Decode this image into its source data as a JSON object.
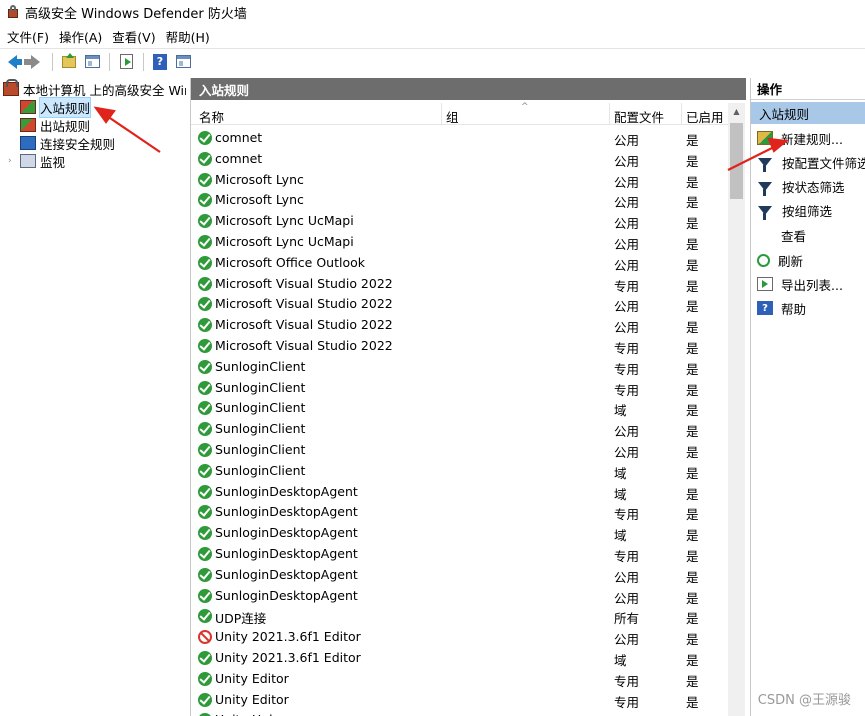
{
  "window": {
    "title": "高级安全 Windows Defender 防火墙"
  },
  "menu": [
    "文件(F)",
    "操作(A)",
    "查看(V)",
    "帮助(H)"
  ],
  "tree": {
    "root": "本地计算机 上的高级安全 Windows Defender 防火墙",
    "items": [
      {
        "label": "入站规则",
        "selected": true
      },
      {
        "label": "出站规则"
      },
      {
        "label": "连接安全规则"
      },
      {
        "label": "监视"
      }
    ]
  },
  "center": {
    "header": "入站规则",
    "columns": {
      "name": "名称",
      "group": "组",
      "profile": "配置文件",
      "enabled": "已启用"
    },
    "rows": [
      {
        "name": "comnet",
        "profile": "公用",
        "enabled": "是",
        "status": "allow"
      },
      {
        "name": "comnet",
        "profile": "公用",
        "enabled": "是",
        "status": "allow"
      },
      {
        "name": "Microsoft Lync",
        "profile": "公用",
        "enabled": "是",
        "status": "allow"
      },
      {
        "name": "Microsoft Lync",
        "profile": "公用",
        "enabled": "是",
        "status": "allow"
      },
      {
        "name": "Microsoft Lync UcMapi",
        "profile": "公用",
        "enabled": "是",
        "status": "allow"
      },
      {
        "name": "Microsoft Lync UcMapi",
        "profile": "公用",
        "enabled": "是",
        "status": "allow"
      },
      {
        "name": "Microsoft Office Outlook",
        "profile": "公用",
        "enabled": "是",
        "status": "allow"
      },
      {
        "name": "Microsoft Visual Studio 2022",
        "profile": "专用",
        "enabled": "是",
        "status": "allow"
      },
      {
        "name": "Microsoft Visual Studio 2022",
        "profile": "公用",
        "enabled": "是",
        "status": "allow"
      },
      {
        "name": "Microsoft Visual Studio 2022",
        "profile": "公用",
        "enabled": "是",
        "status": "allow"
      },
      {
        "name": "Microsoft Visual Studio 2022",
        "profile": "专用",
        "enabled": "是",
        "status": "allow"
      },
      {
        "name": "SunloginClient",
        "profile": "专用",
        "enabled": "是",
        "status": "allow"
      },
      {
        "name": "SunloginClient",
        "profile": "专用",
        "enabled": "是",
        "status": "allow"
      },
      {
        "name": "SunloginClient",
        "profile": "域",
        "enabled": "是",
        "status": "allow"
      },
      {
        "name": "SunloginClient",
        "profile": "公用",
        "enabled": "是",
        "status": "allow"
      },
      {
        "name": "SunloginClient",
        "profile": "公用",
        "enabled": "是",
        "status": "allow"
      },
      {
        "name": "SunloginClient",
        "profile": "域",
        "enabled": "是",
        "status": "allow"
      },
      {
        "name": "SunloginDesktopAgent",
        "profile": "域",
        "enabled": "是",
        "status": "allow"
      },
      {
        "name": "SunloginDesktopAgent",
        "profile": "专用",
        "enabled": "是",
        "status": "allow"
      },
      {
        "name": "SunloginDesktopAgent",
        "profile": "域",
        "enabled": "是",
        "status": "allow"
      },
      {
        "name": "SunloginDesktopAgent",
        "profile": "专用",
        "enabled": "是",
        "status": "allow"
      },
      {
        "name": "SunloginDesktopAgent",
        "profile": "公用",
        "enabled": "是",
        "status": "allow"
      },
      {
        "name": "SunloginDesktopAgent",
        "profile": "公用",
        "enabled": "是",
        "status": "allow"
      },
      {
        "name": "UDP连接",
        "profile": "所有",
        "enabled": "是",
        "status": "allow"
      },
      {
        "name": "Unity 2021.3.6f1 Editor",
        "profile": "公用",
        "enabled": "是",
        "status": "block"
      },
      {
        "name": "Unity 2021.3.6f1 Editor",
        "profile": "域",
        "enabled": "是",
        "status": "allow"
      },
      {
        "name": "Unity Editor",
        "profile": "专用",
        "enabled": "是",
        "status": "allow"
      },
      {
        "name": "Unity Editor",
        "profile": "专用",
        "enabled": "是",
        "status": "allow"
      },
      {
        "name": "Unity Hub",
        "profile": "域",
        "enabled": "是",
        "status": "allow"
      }
    ]
  },
  "actions": {
    "header": "操作",
    "section": "入站规则",
    "items": [
      {
        "label": "新建规则...",
        "icon": "new-rule"
      },
      {
        "label": "按配置文件筛选",
        "icon": "filter"
      },
      {
        "label": "按状态筛选",
        "icon": "filter"
      },
      {
        "label": "按组筛选",
        "icon": "filter"
      },
      {
        "label": "查看",
        "icon": "blank"
      },
      {
        "label": "刷新",
        "icon": "refresh"
      },
      {
        "label": "导出列表...",
        "icon": "export"
      },
      {
        "label": "帮助",
        "icon": "help"
      }
    ]
  },
  "watermark": "CSDN @王源骏",
  "colors": {
    "header_bg": "#6d6d6d",
    "section_bg": "#a9c8e8",
    "selected_bg": "#cce8ff",
    "annotation": "#e0241b"
  }
}
